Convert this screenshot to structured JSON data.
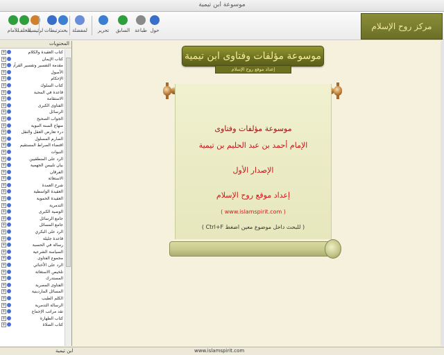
{
  "window": {
    "title": "موسوعة ابن تيمية"
  },
  "toolbar": {
    "buttons": [
      {
        "label": "للأمام",
        "icon": "forward-icon",
        "color": "#2f9e3c"
      },
      {
        "label": "للخلف",
        "icon": "back-icon",
        "color": "#2f9e3c"
      },
      {
        "label": "الرئيسية",
        "icon": "home-icon",
        "color": "#d0802b"
      },
      {
        "label": "مرتبطات",
        "icon": "contents-icon",
        "color": "#3a6fc9"
      },
      {
        "label": "بحث",
        "icon": "search-icon",
        "color": "#3d7fd0"
      },
      {
        "label": "المفضلة",
        "icon": "favorites-icon",
        "color": "#6a8fd8"
      },
      {
        "label": "تحرير",
        "icon": "edit-icon",
        "color": "#3a7fd0"
      },
      {
        "label": "السابق",
        "icon": "history-icon",
        "color": "#2f9e3c"
      },
      {
        "label": "طباعة",
        "icon": "print-icon",
        "color": "#8a8a8a"
      },
      {
        "label": "حول",
        "icon": "about-icon",
        "color": "#3a6fc9"
      }
    ],
    "logo_text": "مركز روح الإسلام"
  },
  "sidebar": {
    "header": "المحتويات",
    "items": [
      "كتاب العقيدة والكلام",
      "كتاب الإيمان",
      "مقدمة التفسير وتفسير القرآن",
      "الأصول",
      "الإحكام",
      "كتاب السلوك",
      "قاعدة في المحبة",
      "الاستقامة",
      "الفتاوى الكبرى",
      "الرسائل",
      "الجواب الصحيح",
      "منهاج السنة النبوية",
      "درء تعارض العقل والنقل",
      "الصارم المسلول",
      "اقتضاء الصراط المستقيم",
      "النبوات",
      "الرد على المنطقيين",
      "بيان تلبيس الجهمية",
      "الفرقان",
      "الاستغاثة",
      "شرح العمدة",
      "العقيدة الواسطية",
      "العقيدة الحموية",
      "التدمرية",
      "الوصية الكبرى",
      "جامع الرسائل",
      "جامع المسائل",
      "الرد على البكري",
      "قاعدة جليلة",
      "رسالة في الحسبة",
      "السياسة الشرعية",
      "مجموع الفتاوى",
      "الرد على الأخنائي",
      "تلخيص الاستغاثة",
      "المستدرك",
      "الفتاوى المصرية",
      "المسائل الماردينية",
      "الكلم الطيب",
      "الرسالة التدمرية",
      "نقد مراتب الإجماع",
      "كتاب الطهارة",
      "كتاب الصلاة"
    ]
  },
  "main": {
    "title": "موسوعة مؤلفات وفتاوى ابن تيمية",
    "subtitle": "إعداد موقع روح الإسلام",
    "lines": [
      {
        "text": "موسوعة مؤلفات وفتاوى",
        "color": "#9b1414"
      },
      {
        "text": "الإمام أحمد بن عبد الحليم بن تيمية",
        "color": "#c21717"
      },
      {
        "text": "الإصدار الأول",
        "color": "#c21717"
      },
      {
        "text": "إعداد موقع روح الإسلام",
        "color": "#d11818"
      },
      {
        "text": "( www.islamspirit.com )",
        "color": "#d11818"
      },
      {
        "text": "( للبحث داخل موضوع معين اضغط Ctrl+F )",
        "color": "#333333"
      }
    ]
  },
  "status": {
    "left": "",
    "center": "www.islamspirit.com",
    "right": "ابن تيمية"
  }
}
